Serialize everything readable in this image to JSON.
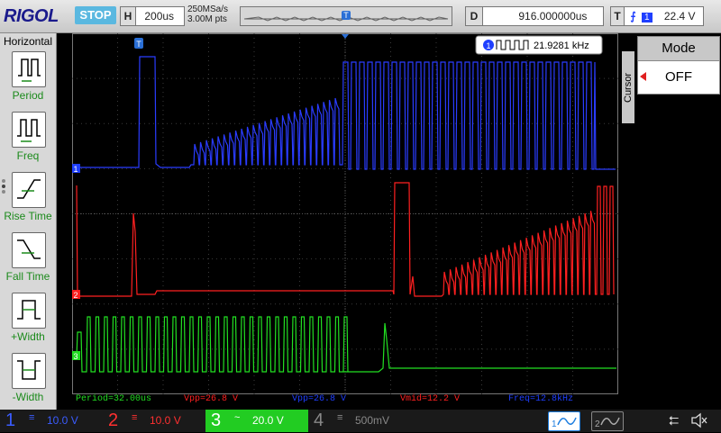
{
  "brand": "RIGOL",
  "run_state": "STOP",
  "timebase": {
    "key": "H",
    "value": "200us"
  },
  "sample_rate": "250MSa/s",
  "memory_depth": "3.00M pts",
  "trigger_marker": "T",
  "delay": {
    "key": "D",
    "value": "916.000000us"
  },
  "trigger": {
    "key": "T",
    "source": "1",
    "level": "22.4 V"
  },
  "left_panel": {
    "title": "Horizontal",
    "items": [
      {
        "label": "Period"
      },
      {
        "label": "Freq"
      },
      {
        "label": "Rise Time"
      },
      {
        "label": "Fall Time"
      },
      {
        "label": "+Width"
      },
      {
        "label": "-Width"
      }
    ]
  },
  "freq_counter": {
    "channel": "1",
    "value": "21.9281 kHz"
  },
  "right_panel": {
    "vertical_label": "Cursor",
    "mode_label": "Mode",
    "mode_value": "OFF"
  },
  "channel_markers": {
    "ch1": "1",
    "ch2": "2",
    "ch3": "3"
  },
  "measurements": {
    "m1": "Period=32.00us",
    "m2": "Vpp=26.8 V",
    "m3": "Vpp=26.8 V",
    "m4": "Vmid=12.2 V",
    "m5": "Freq=12.8kHz"
  },
  "channels": [
    {
      "num": "1",
      "coupling": "≡",
      "scale": "10.0 V",
      "color": "#1f3fff"
    },
    {
      "num": "2",
      "coupling": "≡",
      "scale": "10.0 V",
      "color": "#ff2020"
    },
    {
      "num": "3",
      "coupling": "~",
      "scale": "20.0 V",
      "color": "#22dd22"
    },
    {
      "num": "4",
      "coupling": "≡",
      "scale": "500mV",
      "color": "#888888"
    }
  ],
  "colors": {
    "ch1": "#2a3cff",
    "ch2": "#ff2020",
    "ch3": "#22e022",
    "grid": "#3a3a3a",
    "grid_border": "#777777"
  }
}
